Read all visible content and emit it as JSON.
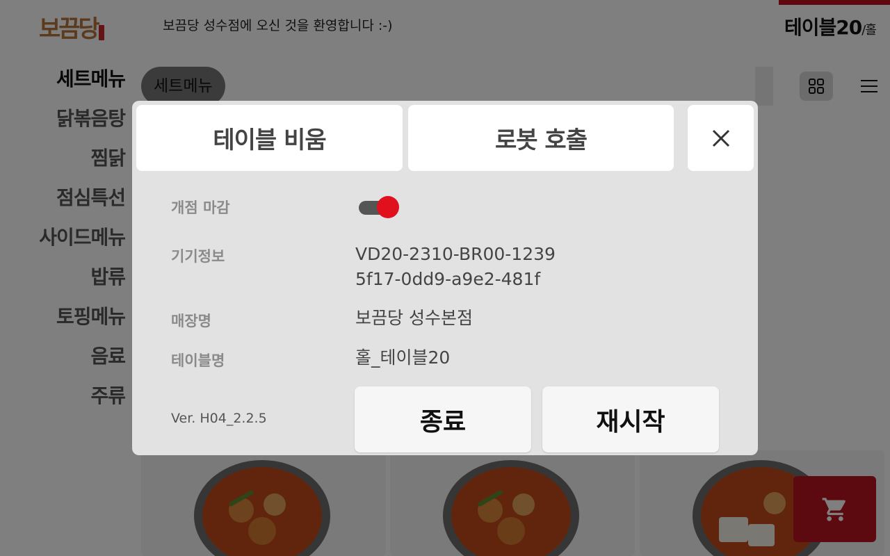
{
  "header": {
    "logo_text": "보끔당",
    "welcome": "보끔당 성수점에 오신 것을 환영합니다 :-)",
    "table_name": "테이블20",
    "table_suffix": "/홀"
  },
  "categories": [
    {
      "label": "세트메뉴",
      "active": true
    },
    {
      "label": "닭볶음탕",
      "active": false
    },
    {
      "label": "찜닭",
      "active": false
    },
    {
      "label": "점심특선",
      "active": false
    },
    {
      "label": "사이드메뉴",
      "active": false
    },
    {
      "label": "밥류",
      "active": false
    },
    {
      "label": "토핑메뉴",
      "active": false
    },
    {
      "label": "음료",
      "active": false
    },
    {
      "label": "주류",
      "active": false
    }
  ],
  "subcategory_chip": "세트메뉴",
  "icons": {
    "grid": "grid-view-icon",
    "menu": "hamburger-menu-icon",
    "cart": "cart-icon",
    "close": "close-icon"
  },
  "modal": {
    "empty_table_label": "테이블 비움",
    "robot_call_label": "로봇 호출",
    "rows": {
      "open_close_label": "개점 마감",
      "open_close_on": true,
      "device_info_label": "기기정보",
      "device_info_line1": "VD20-2310-BR00-1239",
      "device_info_line2": "5f17-0dd9-a9e2-481f",
      "store_name_label": "매장명",
      "store_name_value": "보끔당 성수본점",
      "table_name_label": "테이블명",
      "table_name_value": "홀_테이블20"
    },
    "version": "Ver. H04_2.2.5",
    "exit_label": "종료",
    "restart_label": "재시작"
  },
  "colors": {
    "accent_red": "#c0111f",
    "toggle_knob": "#e0101c",
    "modal_bg": "#e2e2e2"
  }
}
